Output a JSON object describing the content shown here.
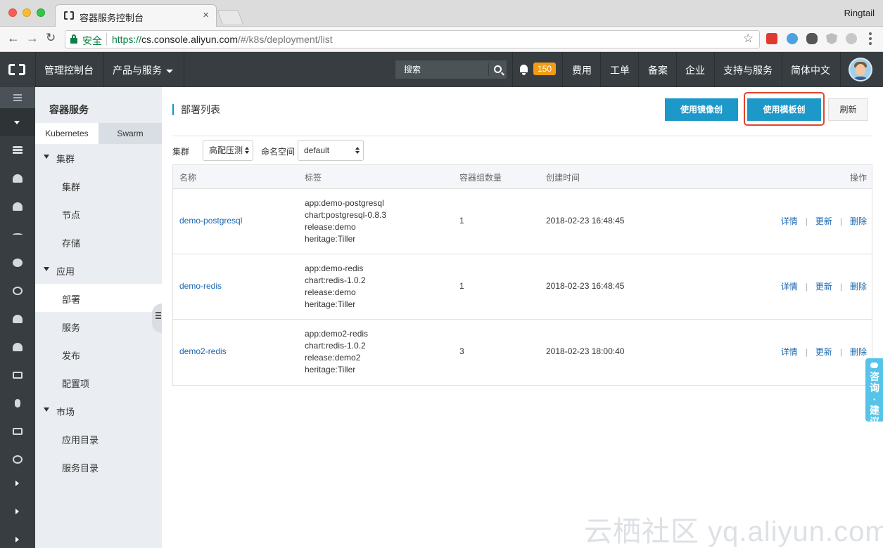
{
  "browser": {
    "tab_title": "容器服务控制台",
    "tab_close": "×",
    "profile": "Ringtail",
    "secure_label": "安全",
    "url_scheme": "https://",
    "url_host": "cs.console.aliyun.com",
    "url_path": "/#/k8s/deployment/list"
  },
  "topnav": {
    "console": "管理控制台",
    "products": "产品与服务",
    "search_placeholder": "搜索",
    "notification_count": "150",
    "links": [
      "费用",
      "工单",
      "备案",
      "企业",
      "支持与服务",
      "简体中文"
    ]
  },
  "sidebar": {
    "title": "容器服务",
    "tabs": [
      "Kubernetes",
      "Swarm"
    ],
    "groups": [
      {
        "label": "集群",
        "items": [
          "集群",
          "节点",
          "存储"
        ]
      },
      {
        "label": "应用",
        "items": [
          "部署",
          "服务",
          "发布",
          "配置项"
        ]
      },
      {
        "label": "市场",
        "items": [
          "应用目录",
          "服务目录"
        ]
      }
    ],
    "active_item": "部署"
  },
  "main": {
    "title": "部署列表",
    "buttons": {
      "create_image": "使用镜像创建",
      "create_template": "使用模板创建",
      "refresh": "刷新"
    },
    "filters": {
      "cluster_label": "集群",
      "cluster_value": "高配压测",
      "namespace_label": "命名空间",
      "namespace_value": "default"
    },
    "table": {
      "headers": [
        "名称",
        "标签",
        "容器组数量",
        "创建时间",
        "操作"
      ],
      "rows": [
        {
          "name": "demo-postgresql",
          "labels": [
            "app:demo-postgresql",
            "chart:postgresql-0.8.3",
            "release:demo",
            "heritage:Tiller"
          ],
          "count": "1",
          "created": "2018-02-23 16:48:45"
        },
        {
          "name": "demo-redis",
          "labels": [
            "app:demo-redis",
            "chart:redis-1.0.2",
            "release:demo",
            "heritage:Tiller"
          ],
          "count": "1",
          "created": "2018-02-23 16:48:45"
        },
        {
          "name": "demo2-redis",
          "labels": [
            "app:demo2-redis",
            "chart:redis-1.0.2",
            "release:demo2",
            "heritage:Tiller"
          ],
          "count": "3",
          "created": "2018-02-23 18:00:40"
        }
      ],
      "actions": [
        "详情",
        "更新",
        "删除"
      ],
      "action_separator": "|"
    }
  },
  "feedback": "咨询·建议",
  "watermark": "云栖社区 yq.aliyun.com",
  "colors": {
    "topnav_bg": "#373d41",
    "primary": "#1c98c9",
    "highlight": "#e4442a",
    "link": "#1b67b0",
    "badge": "#f39c12"
  }
}
